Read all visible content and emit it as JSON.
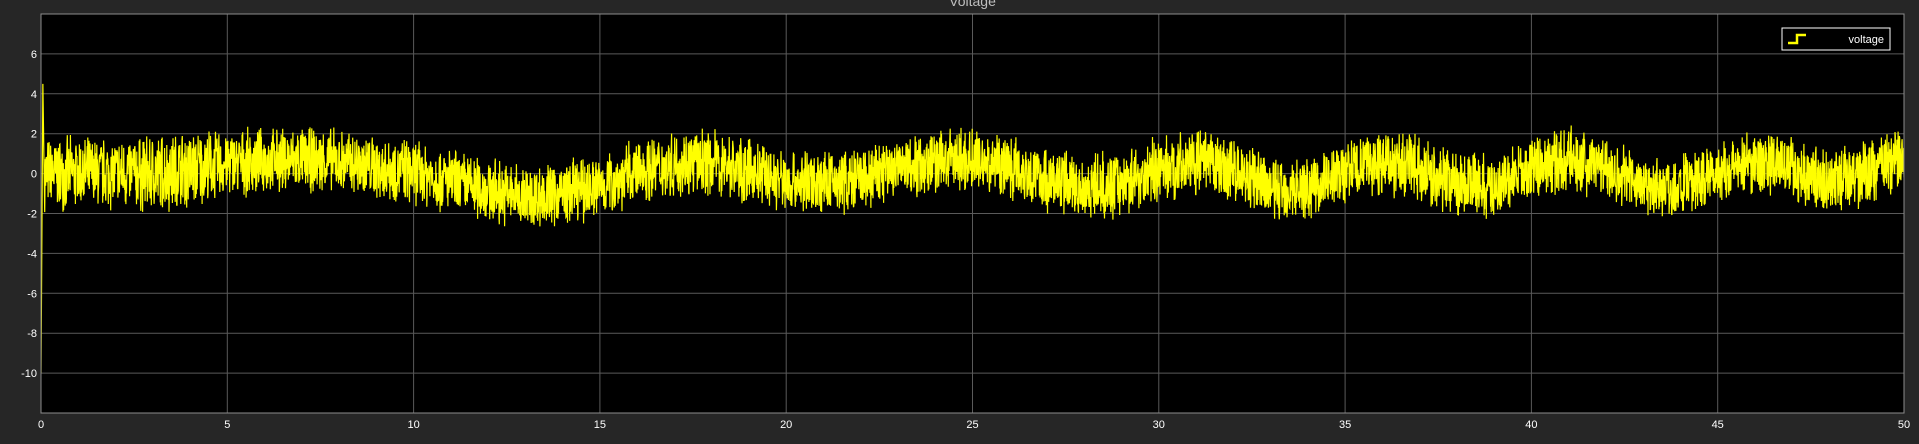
{
  "window": {
    "background": "#262626"
  },
  "chart_data": {
    "type": "line",
    "title": "Voltage",
    "xlabel": "",
    "ylabel": "",
    "xlim": [
      0,
      50
    ],
    "ylim": [
      -12,
      8
    ],
    "xticks": [
      0,
      5,
      10,
      15,
      20,
      25,
      30,
      35,
      40,
      45,
      50
    ],
    "yticks": [
      -10,
      -8,
      -6,
      -4,
      -2,
      0,
      2,
      4,
      6
    ],
    "grid": true,
    "legend": {
      "placement": "top-right",
      "entries": [
        "voltage"
      ]
    },
    "colors": {
      "plot_bg": "#000000",
      "grid": "#5a5a5a",
      "series": "#ffff00",
      "axes_frame": "#8c8c8c"
    },
    "series": [
      {
        "name": "voltage",
        "x": [
          0,
          0.05,
          0.1,
          1,
          2,
          3,
          4,
          5,
          6,
          7,
          8,
          9,
          10,
          11,
          12,
          13,
          14,
          15,
          16,
          17,
          18,
          19,
          20,
          21,
          22,
          23,
          24,
          25,
          26,
          27,
          28,
          29,
          30,
          31,
          32,
          33,
          34,
          35,
          36,
          37,
          38,
          39,
          40,
          41,
          42,
          43,
          44,
          45,
          46,
          47,
          48,
          49,
          50
        ],
        "center": [
          -10,
          4.5,
          0,
          0,
          0,
          0,
          0.2,
          0.5,
          0.6,
          0.7,
          0.6,
          0.3,
          0.1,
          -0.4,
          -0.8,
          -1.2,
          -1.0,
          -0.6,
          0.1,
          0.5,
          0.6,
          0.1,
          -0.4,
          -0.5,
          -0.3,
          0.3,
          0.6,
          0.7,
          0.4,
          -0.3,
          -0.7,
          -0.5,
          0.2,
          0.6,
          0.2,
          -0.8,
          -0.7,
          0.1,
          0.6,
          0.2,
          -0.5,
          -0.7,
          0.2,
          0.7,
          0.3,
          -0.6,
          -0.7,
          0.1,
          0.6,
          0.3,
          -0.5,
          0.1,
          0.8
        ],
        "amplitude": [
          0,
          0,
          2.0,
          2.0,
          2.0,
          2.2,
          2.2,
          1.8,
          1.8,
          1.8,
          1.8,
          1.8,
          1.8,
          1.8,
          1.8,
          1.8,
          1.8,
          1.8,
          1.8,
          1.8,
          1.8,
          1.8,
          1.8,
          1.8,
          1.8,
          1.8,
          1.8,
          1.8,
          1.8,
          1.8,
          1.8,
          1.8,
          1.8,
          1.8,
          1.8,
          1.8,
          1.8,
          1.8,
          1.8,
          1.8,
          1.8,
          1.8,
          1.8,
          1.8,
          1.8,
          1.8,
          1.8,
          1.8,
          1.8,
          1.8,
          1.8,
          1.8,
          1.8
        ]
      }
    ]
  }
}
